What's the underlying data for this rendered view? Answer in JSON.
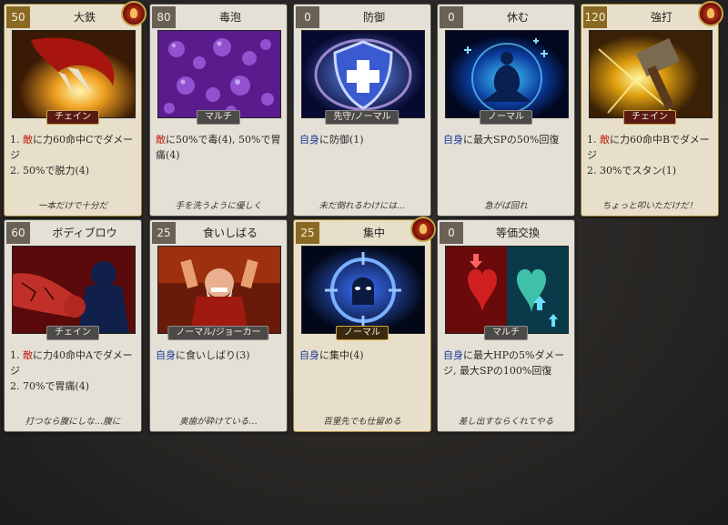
{
  "cards": [
    {
      "cost": "50",
      "name": "大鉄",
      "tag": "チェイン",
      "tag_style": "red",
      "gold": true,
      "emblem": true,
      "desc": [
        {
          "t": "1. "
        },
        {
          "t": "敵",
          "k": "enemy"
        },
        {
          "t": "に力60命中Cでダメージ\n2. 50%で脱力(4)"
        }
      ],
      "flavor": "一本だけで十分だ",
      "art": "claw"
    },
    {
      "cost": "80",
      "name": "毒泡",
      "tag": "マルチ",
      "tag_style": "grey",
      "gold": false,
      "emblem": false,
      "desc": [
        {
          "t": "敵",
          "k": "enemy"
        },
        {
          "t": "に50%で毒(4), 50%で胃痛(4)"
        }
      ],
      "flavor": "手を洗うように優しく",
      "art": "bubbles"
    },
    {
      "cost": "0",
      "name": "防御",
      "tag": "先守/ノーマル",
      "tag_style": "grey",
      "gold": false,
      "emblem": false,
      "desc": [
        {
          "t": "自身",
          "k": "self"
        },
        {
          "t": "に防御(1)"
        }
      ],
      "flavor": "未だ倒れるわけには…",
      "art": "shield"
    },
    {
      "cost": "0",
      "name": "休む",
      "tag": "ノーマル",
      "tag_style": "grey",
      "gold": false,
      "emblem": false,
      "desc": [
        {
          "t": "自身",
          "k": "self"
        },
        {
          "t": "に最大SPの50%回復"
        }
      ],
      "flavor": "急がば回れ",
      "art": "rest"
    },
    {
      "cost": "120",
      "name": "強打",
      "tag": "チェイン",
      "tag_style": "red",
      "gold": true,
      "emblem": true,
      "desc": [
        {
          "t": "1. "
        },
        {
          "t": "敵",
          "k": "enemy"
        },
        {
          "t": "に力60命中Bでダメージ\n2. 30%でスタン(1)"
        }
      ],
      "flavor": "ちょっと叩いただけだ！",
      "art": "hammer"
    },
    {
      "cost": "60",
      "name": "ボディブロウ",
      "tag": "チェイン",
      "tag_style": "grey",
      "gold": false,
      "emblem": false,
      "desc": [
        {
          "t": "1. "
        },
        {
          "t": "敵",
          "k": "enemy"
        },
        {
          "t": "に力40命中Aでダメージ\n2. 70%で胃痛(4)"
        }
      ],
      "flavor": "打つなら腹にしな…腹に",
      "art": "body"
    },
    {
      "cost": "25",
      "name": "食いしばる",
      "tag": "ノーマル/ジョーカー",
      "tag_style": "grey",
      "gold": false,
      "emblem": false,
      "desc": [
        {
          "t": "自身",
          "k": "self"
        },
        {
          "t": "に食いしばり(3)"
        }
      ],
      "flavor": "奥歯が砕けている…",
      "art": "grit"
    },
    {
      "cost": "25",
      "name": "集中",
      "tag": "ノーマル",
      "tag_style": "gold",
      "gold": true,
      "emblem": true,
      "desc": [
        {
          "t": "自身",
          "k": "self"
        },
        {
          "t": "に集中(4)"
        }
      ],
      "flavor": "百里先でも仕留める",
      "art": "focus"
    },
    {
      "cost": "0",
      "name": "等価交換",
      "tag": "マルチ",
      "tag_style": "grey",
      "gold": false,
      "emblem": false,
      "desc": [
        {
          "t": "自身",
          "k": "self"
        },
        {
          "t": "に最大HPの5%ダメージ, 最大SPの100%回復"
        }
      ],
      "flavor": "差し出すならくれてやる",
      "art": "exchange"
    }
  ]
}
